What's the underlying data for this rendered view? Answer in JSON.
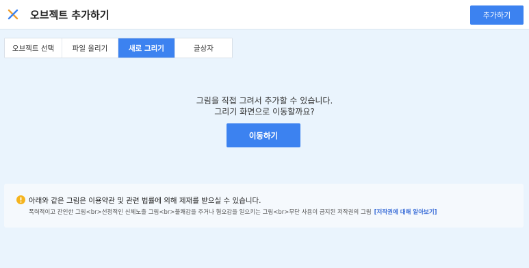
{
  "header": {
    "title": "오브젝트 추가하기",
    "add_button": "추가하기",
    "close_icon": "close-x-icon",
    "close_icon_colors": [
      "#3c82f0",
      "#f0a030"
    ]
  },
  "tabs": [
    {
      "label": "오브젝트 선택",
      "active": false
    },
    {
      "label": "파일 올리기",
      "active": false
    },
    {
      "label": "새로 그리기",
      "active": true
    },
    {
      "label": "글상자",
      "active": false
    }
  ],
  "main": {
    "message_line1": "그림을 직접 그려서 추가할 수 있습니다.",
    "message_line2": "그리기 화면으로 이동할까요?",
    "go_button": "이동하기"
  },
  "notice": {
    "icon": "warning-icon",
    "icon_color": "#f5b41e",
    "title": "아래와 같은 그림은 이용약관 및 관련 법률에 의해 제재를 받으실 수 있습니다.",
    "description": "폭력적이고 잔인한 그림<br>선정적인 신체노출 그림<br>불쾌감을 주거나 혐오감을 일으키는 그림<br>무단 사용이 금지된 저작권의 그림",
    "link": "[저작권에 대해 알아보기]"
  },
  "colors": {
    "accent": "#3c82f0",
    "background": "#eaf4fd",
    "link": "#3c6fd8"
  }
}
